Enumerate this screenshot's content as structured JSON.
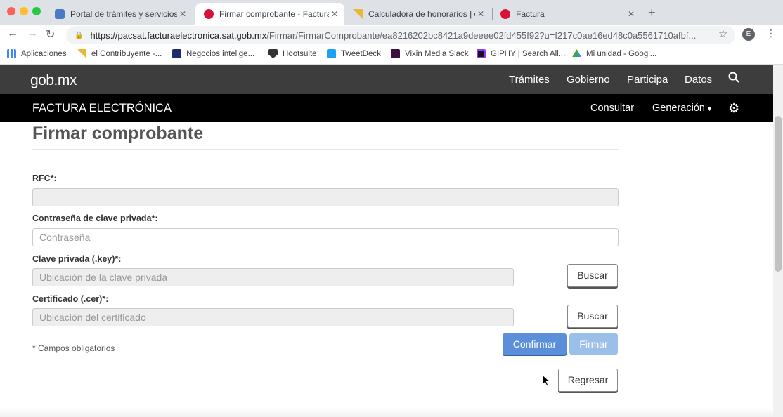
{
  "browser": {
    "tabs": [
      {
        "title": "Portal de trámites y servicios -",
        "favicon": "sat-logo-icon",
        "active": false
      },
      {
        "title": "Firmar comprobante - Factura ",
        "favicon": "red-circle-icon",
        "active": true
      },
      {
        "title": "Calculadora de honorarios | el",
        "favicon": "yellow-flag-icon",
        "active": false
      },
      {
        "title": "Factura",
        "favicon": "red-circle-icon",
        "active": false
      }
    ],
    "url_host": "https://pacsat.facturaelectronica.sat.gob.mx",
    "url_path": "/Firmar/FirmarComprobante/ea8216202bc8421a9deeee02fd455f92?u=f217c0ae16ed48c0a5561710afbf...",
    "profile_initial": "E",
    "bookmarks": [
      {
        "label": "Aplicaciones",
        "icon": "apps-grid-icon"
      },
      {
        "label": "el Contribuyente -...",
        "icon": "yellow-flag-icon"
      },
      {
        "label": "Negocios intelige...",
        "icon": "news-icon"
      },
      {
        "label": "Hootsuite",
        "icon": "owl-icon"
      },
      {
        "label": "TweetDeck",
        "icon": "bird-icon"
      },
      {
        "label": "Vixin Media Slack",
        "icon": "slack-icon"
      },
      {
        "label": "GIPHY | Search All...",
        "icon": "giphy-icon"
      },
      {
        "label": "Mi unidad - Googl...",
        "icon": "drive-icon"
      }
    ]
  },
  "gob_header": {
    "logo": "gob.mx",
    "nav": [
      "Trámites",
      "Gobierno",
      "Participa",
      "Datos"
    ]
  },
  "fe_header": {
    "title": "FACTURA ELECTRÓNICA",
    "consultar": "Consultar",
    "generacion": "Generación"
  },
  "form": {
    "title": "Firmar comprobante",
    "rfc_label": "RFC*:",
    "rfc_value": "",
    "password_label": "Contraseña de clave privada*:",
    "password_placeholder": "Contraseña",
    "key_label": "Clave privada (.key)*:",
    "key_placeholder": "Ubicación de la clave privada",
    "cer_label": "Certificado (.cer)*:",
    "cer_placeholder": "Ubicación del certificado",
    "buscar_label": "Buscar",
    "required_note": "* Campos obligatorios",
    "confirmar_label": "Confirmar",
    "firmar_label": "Firmar",
    "regresar_label": "Regresar"
  },
  "colors": {
    "tabbar_bg": "#dee1e6",
    "gob_bar": "#3d3d3d",
    "fe_bar": "#000000",
    "primary_button": "#5b8fd9",
    "disabled_button": "#9bbfe8"
  }
}
